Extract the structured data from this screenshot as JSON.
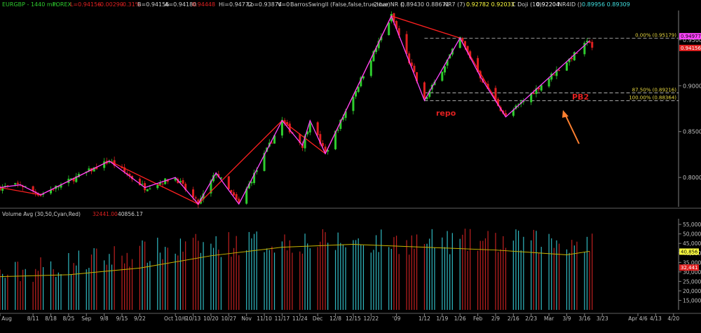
{
  "header": {
    "symbol": "EURGBP - 1440 min",
    "market": "FOREX",
    "last": "L=0.94156",
    "change": "-0.00290",
    "change_pct": "-0.31%",
    "bid": "B=0.94156",
    "ask": "A=0.94180",
    "open": "0.94448",
    "hi": "Hi=0.94772",
    "lo": "Lo=0.93874",
    "volume": "V=0",
    "study1": "BarrosSwingII (False,false,true,true)",
    "study2": "2-bar NR ()",
    "study2_vals": "0.89430  0.88671",
    "study3": "NR7 (7)",
    "study3_vals": "0.92782  0.92033",
    "study4": "C Doji (10)",
    "study4_val": "0.92204",
    "study5": "NR4ID ()",
    "study5_vals": "0.89956  0.89309"
  },
  "volume_header": {
    "title": "Volume Avg (30,50,Cyan,Red)",
    "val1": "32441.00",
    "val2": "40856.17"
  },
  "annotations": {
    "repo": "repo",
    "pb2": "PB2",
    "fib_0": "0.00% (0.95179)",
    "fib_875": "87.50% (0.89216)",
    "fib_100": "100.00% (0.88364)"
  },
  "price_badges": {
    "upper": "0.94977",
    "current": "0.94156"
  },
  "volume_badges": {
    "avg": "40,856",
    "current": "32,441"
  },
  "colors": {
    "background": "#000000",
    "up_candle": "#2ecc2e",
    "down_candle": "#e02020",
    "zigzag_magenta": "#ff44ff",
    "swing_red": "#ff2020",
    "volume_up": "#30b8c0",
    "volume_down": "#c02020",
    "volume_avg": "#c8b400",
    "fib": "#c8c8c8",
    "text": "#c0c0c0",
    "arrow": "#ff8030"
  },
  "chart_data": [
    {
      "type": "candlestick",
      "title": "EURGBP - 1440 min",
      "x_ticks": [
        "7/29 Aug",
        "8/11",
        "8/18",
        "8/25",
        "Sep",
        "9/8",
        "9/15",
        "9/22",
        "Oct 10/6",
        "10/13",
        "10/20",
        "10/27",
        "Nov",
        "11/10",
        "11/17",
        "11/24",
        "Dec",
        "12/8",
        "12/15",
        "12/22",
        "'09",
        "1/12",
        "1/19",
        "1/26",
        "Feb",
        "2/9",
        "2/16",
        "2/23",
        "Mar",
        "3/9",
        "3/16",
        "3/23",
        "Apr 4/6",
        "4/13",
        "4/20"
      ],
      "y_ticks": [
        0.8,
        0.85,
        0.9,
        0.95
      ],
      "y_tick_labels": [
        "0.80000",
        "0.85000",
        "0.90000",
        "0.95000"
      ],
      "ylim": [
        0.768,
        0.982
      ],
      "swing_points": [
        {
          "date": "2008-07-29",
          "price": 0.789
        },
        {
          "date": "2008-08-06",
          "price": 0.792
        },
        {
          "date": "2008-08-14",
          "price": 0.781
        },
        {
          "date": "2008-09-10",
          "price": 0.818
        },
        {
          "date": "2008-09-24",
          "price": 0.789
        },
        {
          "date": "2008-10-06",
          "price": 0.8
        },
        {
          "date": "2008-10-15",
          "price": 0.771
        },
        {
          "date": "2008-10-22",
          "price": 0.805
        },
        {
          "date": "2008-10-31",
          "price": 0.771
        },
        {
          "date": "2008-11-17",
          "price": 0.862
        },
        {
          "date": "2008-11-25",
          "price": 0.835
        },
        {
          "date": "2008-11-28",
          "price": 0.862
        },
        {
          "date": "2008-12-04",
          "price": 0.826
        },
        {
          "date": "2008-12-30",
          "price": 0.976
        },
        {
          "date": "2009-01-12",
          "price": 0.884
        },
        {
          "date": "2009-01-26",
          "price": 0.952
        },
        {
          "date": "2009-02-03",
          "price": 0.91
        },
        {
          "date": "2009-02-13",
          "price": 0.866
        },
        {
          "date": "2009-03-18",
          "price": 0.949
        }
      ],
      "red_swing_points": [
        {
          "date": "2008-07-29",
          "price": 0.789
        },
        {
          "date": "2008-08-14",
          "price": 0.781
        },
        {
          "date": "2008-09-10",
          "price": 0.818
        },
        {
          "date": "2008-10-15",
          "price": 0.771
        },
        {
          "date": "2008-11-17",
          "price": 0.862
        },
        {
          "date": "2008-12-04",
          "price": 0.826
        },
        {
          "date": "2008-12-30",
          "price": 0.976
        },
        {
          "date": "2009-01-26",
          "price": 0.952
        },
        {
          "date": "2009-02-13",
          "price": 0.866
        }
      ],
      "fib_levels": [
        {
          "label": "0.00% (0.95179)",
          "price": 0.95179
        },
        {
          "label": "87.50% (0.89216)",
          "price": 0.89216
        },
        {
          "label": "100.00% (0.88364)",
          "price": 0.88364
        }
      ],
      "last_price": 0.94156
    },
    {
      "type": "bar",
      "title": "Volume Avg (30,50,Cyan,Red)",
      "y_ticks": [
        15000,
        20000,
        25000,
        30000,
        35000,
        40000,
        45000,
        50000,
        55000
      ],
      "y_tick_labels": [
        "15,000",
        "20,000",
        "25,000",
        "30,000",
        "35,000",
        "40,000",
        "45,000",
        "50,000",
        "55,000"
      ],
      "ylim": [
        10000,
        58000
      ],
      "avg_line": [
        {
          "date": "2008-07-29",
          "value": 27500
        },
        {
          "date": "2008-08-25",
          "value": 28500
        },
        {
          "date": "2008-09-22",
          "value": 32000
        },
        {
          "date": "2008-10-20",
          "value": 38500
        },
        {
          "date": "2008-11-17",
          "value": 43000
        },
        {
          "date": "2008-12-15",
          "value": 44500
        },
        {
          "date": "2009-01-12",
          "value": 43000
        },
        {
          "date": "2009-02-09",
          "value": 41500
        },
        {
          "date": "2009-03-09",
          "value": 39000
        },
        {
          "date": "2009-03-18",
          "value": 40856
        }
      ],
      "last_volume": 32441,
      "last_avg": 40856.17
    }
  ]
}
